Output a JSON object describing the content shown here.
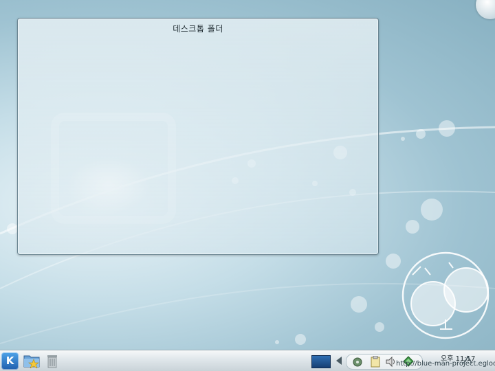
{
  "desktop": {
    "folder_view": {
      "title": "데스크톱 폴더"
    }
  },
  "panel": {
    "launcher_icon": "kde-k-icon",
    "quick_launch": [
      "folder-favorites-icon",
      "trash-icon"
    ],
    "pager_icon": "virtual-desktop-pager-icon",
    "tray_icons": [
      "network-icon",
      "clipboard-icon",
      "volume-icon",
      "update-notifier-icon"
    ],
    "clock": "오후 11:17",
    "watermark": "http://blue-man-project.egloos.com"
  },
  "colors": {
    "kde_blue": "#1f5fae",
    "panel_bg": "#dfe6ea",
    "wallpaper": "#9fc3d2"
  }
}
